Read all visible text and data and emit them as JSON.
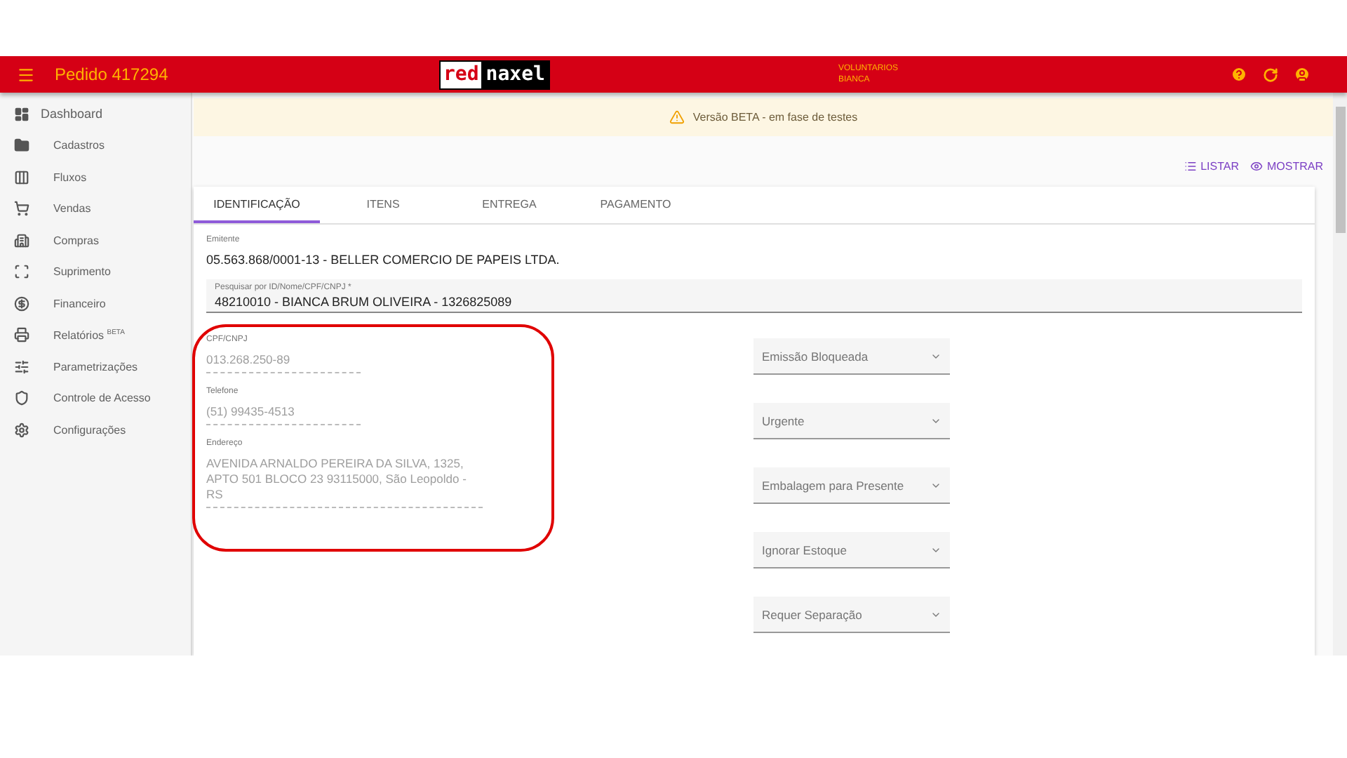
{
  "header": {
    "title": "Pedido 417294",
    "logo": {
      "part_1": "red",
      "part_2": "naxel"
    },
    "user": {
      "line_1": "VOLUNTARIOS",
      "line_2": "BIANCA"
    }
  },
  "sidebar": {
    "items": [
      {
        "label": "Dashboard"
      },
      {
        "label": "Cadastros"
      },
      {
        "label": "Fluxos"
      },
      {
        "label": "Vendas"
      },
      {
        "label": "Compras"
      },
      {
        "label": "Suprimento"
      },
      {
        "label": "Financeiro"
      },
      {
        "label": "Relatórios $^{BETA}$"
      },
      {
        "label": "Parametrizações"
      },
      {
        "label": "Controle de Acesso"
      },
      {
        "label": "Configurações"
      }
    ]
  },
  "banner": {
    "text": "Versão BETA - em fase de testes"
  },
  "actions": [
    {
      "label": "LISTAR"
    },
    {
      "label": "MOSTRAR"
    }
  ],
  "tabs": [
    {
      "label": "IDENTIFICAÇÃO",
      "selected": true
    },
    {
      "label": "ITENS",
      "selected": false
    },
    {
      "label": "ENTREGA",
      "selected": false
    },
    {
      "label": "PAGAMENTO",
      "selected": false
    }
  ],
  "emitente": {
    "label": "Emitente",
    "value": "05.563.868/0001-13 - BELLER COMERCIO DE PAPEIS LTDA."
  },
  "search": {
    "label": "Pesquisar por ID/Nome/CPF/CNPJ *",
    "value": "48210010 - BIANCA BRUM OLIVEIRA -  1326825089"
  },
  "client_fields": [
    {
      "label": "CPF/CNPJ",
      "value": "013.268.250-89",
      "disabled": true
    },
    {
      "label": "Telefone",
      "value": "(51) 99435-4513",
      "disabled": true
    },
    {
      "label": "Endereço",
      "value": "AVENIDA ARNALDO PEREIRA DA SILVA, 1325, APTO 501 BLOCO 23 93115000, São Leopoldo - RS",
      "disabled": true
    }
  ],
  "selects": [
    {
      "placeholder": "Emissão Bloqueada"
    },
    {
      "placeholder": "Urgente"
    },
    {
      "placeholder": "Embalagem para Presente"
    },
    {
      "placeholder": "Ignorar Estoque"
    },
    {
      "placeholder": "Requer Separação"
    }
  ]
}
